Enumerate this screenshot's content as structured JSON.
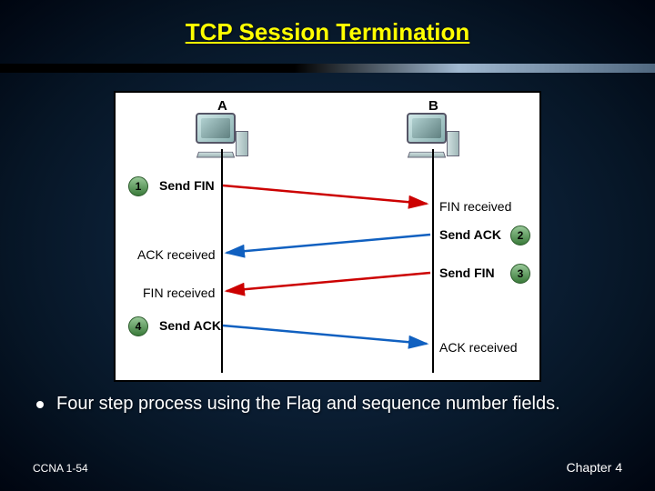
{
  "title": "TCP Session Termination",
  "diagram": {
    "hostA": "A",
    "hostB": "B",
    "steps": {
      "s1": "1",
      "s2": "2",
      "s3": "3",
      "s4": "4"
    },
    "labels": {
      "sendFin1": "Send FIN",
      "finReceived1": "FIN received",
      "sendAck1": "Send ACK",
      "ackReceived1": "ACK received",
      "sendFin2": "Send FIN",
      "finReceived2": "FIN received",
      "sendAck2": "Send ACK",
      "ackReceived2": "ACK received"
    }
  },
  "bullet": "Four step process using the Flag and sequence number fields.",
  "footer": {
    "left": "CCNA 1-54",
    "right": "Chapter 4"
  }
}
